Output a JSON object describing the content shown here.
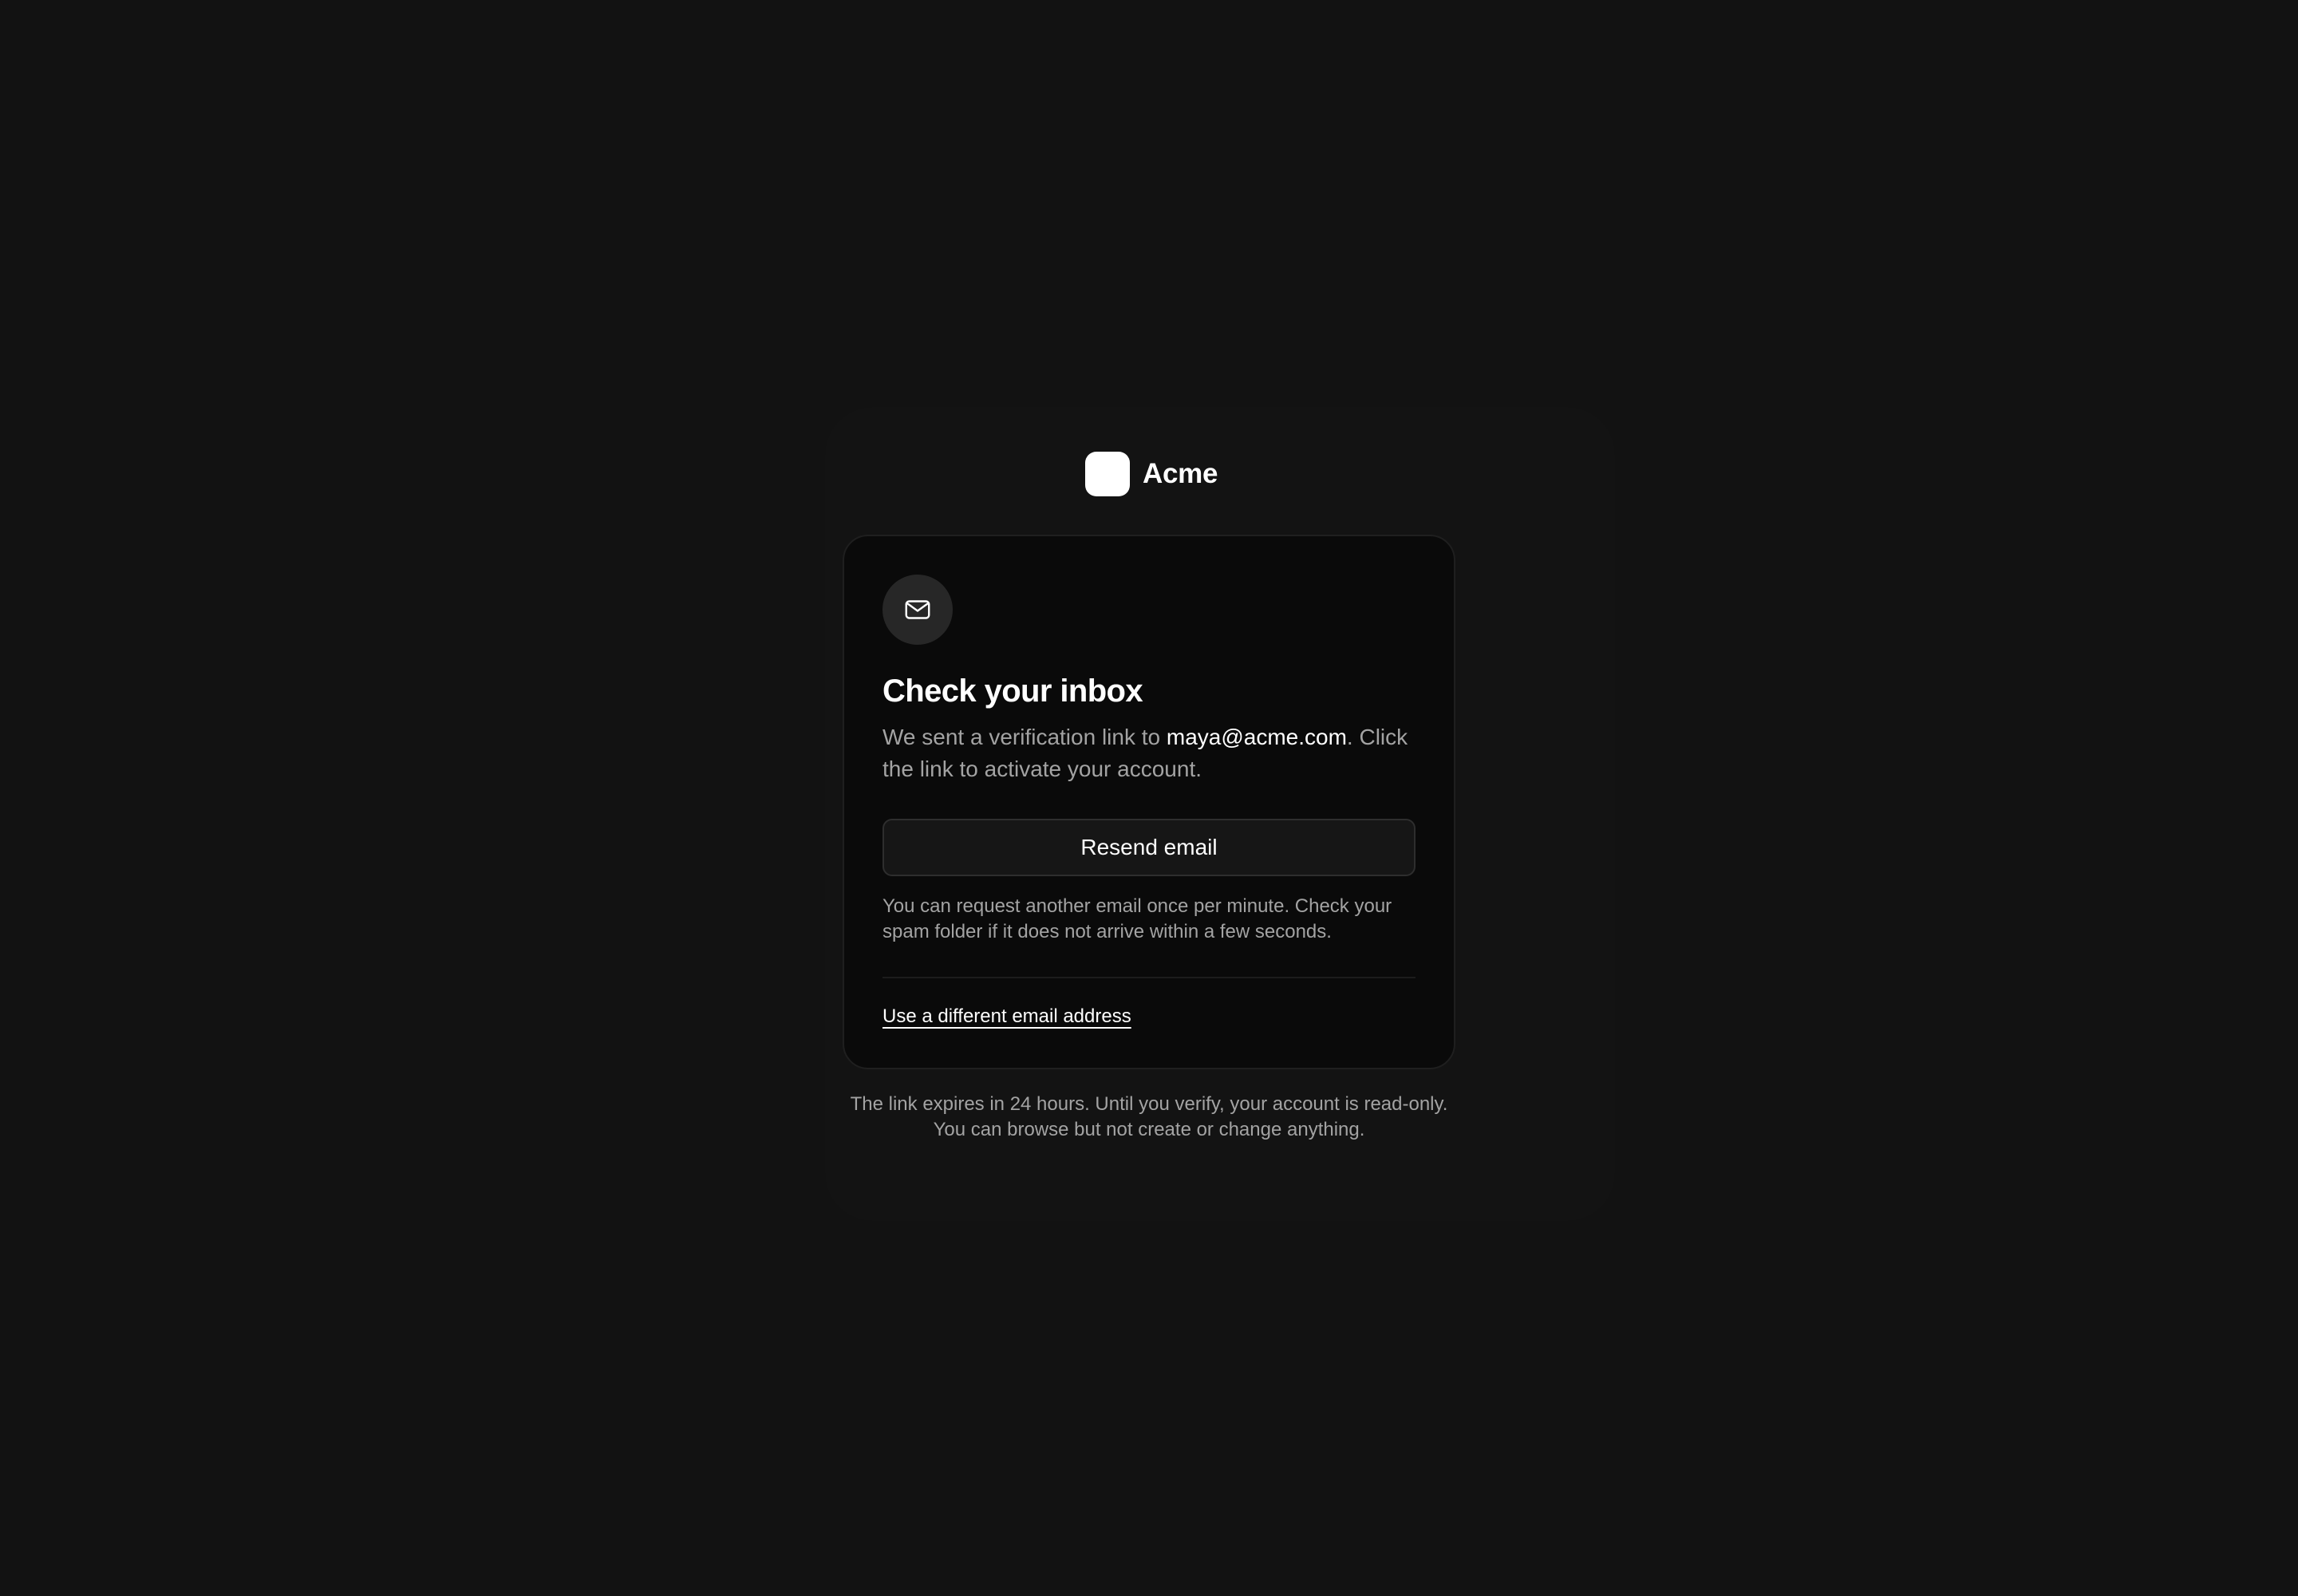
{
  "brand": {
    "name": "Acme",
    "logo_color": "#ffffff"
  },
  "card": {
    "icon": "mail-icon",
    "title": "Check your inbox",
    "description_prefix": "We sent a verification link to ",
    "email": "maya@acme.com",
    "description_suffix": ". Click the link to activate your account.",
    "resend_label": "Resend email",
    "hint": "You can request another email once per minute. Check your spam folder if it does not arrive within a few seconds.",
    "alt_link": "Use a different email address"
  },
  "footer": {
    "note": "The link expires in 24 hours. Until you verify, your account is read-only. You can browse but not create or change anything."
  },
  "colors": {
    "background": "#121212",
    "card": "#0a0a0a",
    "muted_text": "#a3a3a3",
    "text": "#ffffff"
  }
}
